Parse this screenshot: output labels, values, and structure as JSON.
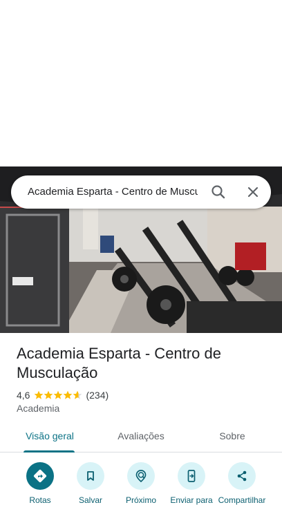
{
  "search": {
    "query": "Academia Esparta - Centro de Musculação"
  },
  "place": {
    "name": "Academia Esparta - Centro de Musculação",
    "rating": "4,6",
    "rating_value": 4.6,
    "review_count": "(234)",
    "category": "Academia"
  },
  "tabs": [
    {
      "label": "Visão geral"
    },
    {
      "label": "Avaliações"
    },
    {
      "label": "Sobre"
    }
  ],
  "actions": [
    {
      "label": "Rotas",
      "icon": "directions-icon"
    },
    {
      "label": "Salvar",
      "icon": "bookmark-icon"
    },
    {
      "label": "Próximo",
      "icon": "nearby-icon"
    },
    {
      "label": "Enviar para",
      "icon": "send-to-phone-icon"
    },
    {
      "label": "Compartilhar",
      "icon": "share-icon"
    }
  ],
  "colors": {
    "accent": "#0b7285",
    "star": "#fbbc04",
    "action_bg": "#d8f3f7"
  }
}
